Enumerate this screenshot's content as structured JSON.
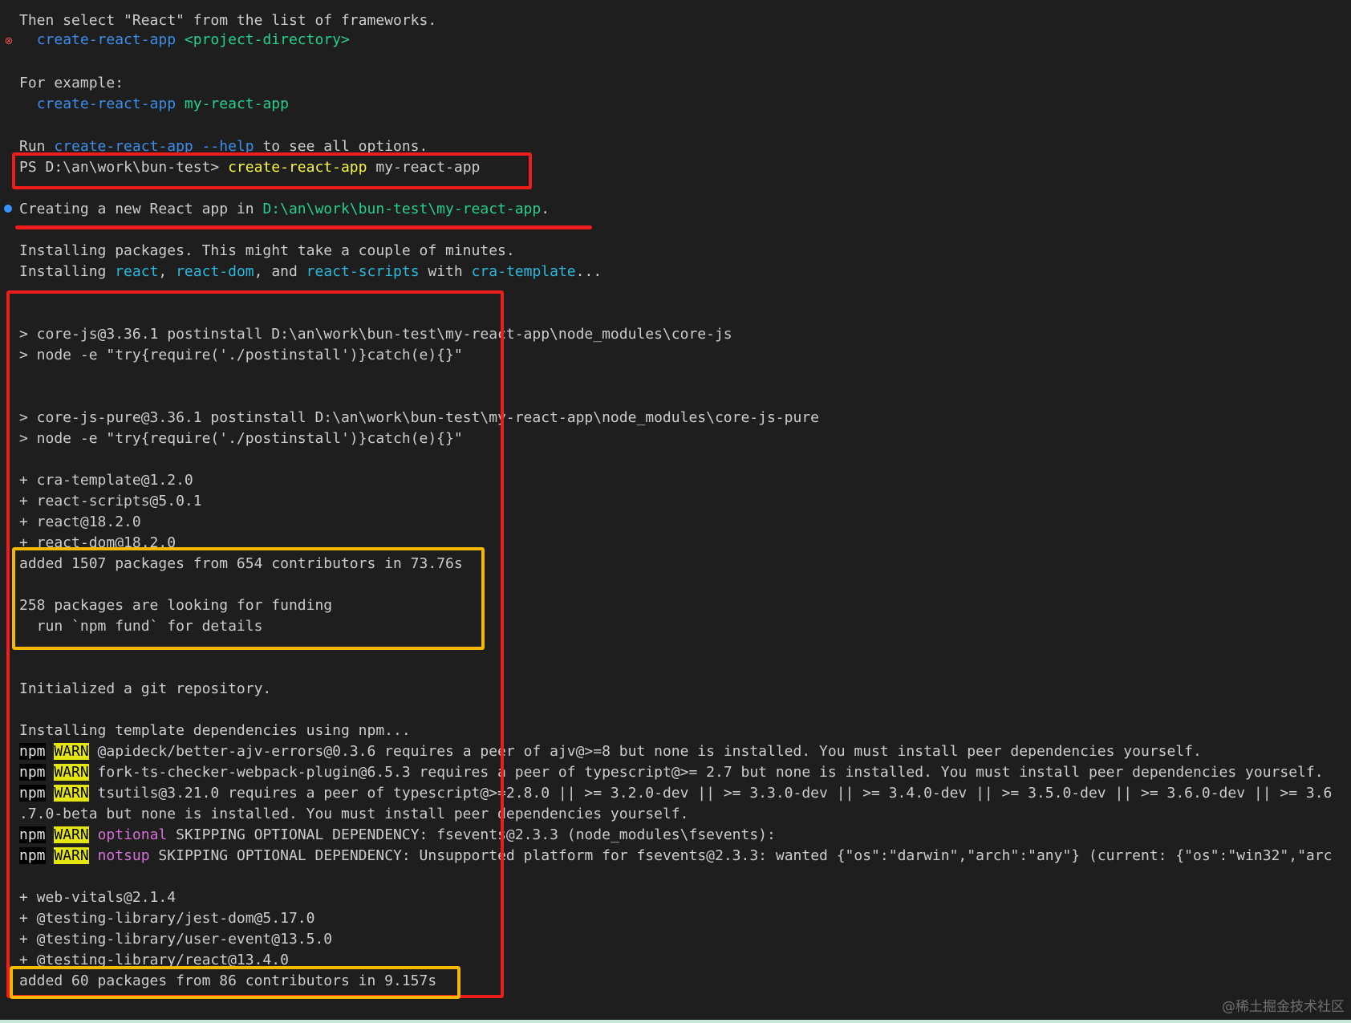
{
  "terminal": {
    "lines": {
      "select_react": "Then select \"React\" from the list of frameworks.",
      "usage_cmd": "create-react-app",
      "usage_arg": "<project-directory>",
      "for_example": "For example:",
      "example_cmd": "create-react-app",
      "example_arg": "my-react-app",
      "run_prefix": "Run ",
      "run_cmd": "create-react-app --help",
      "run_suffix": " to see all options.",
      "prompt": "PS D:\\an\\work\\bun-test> ",
      "prompt_cmd": "create-react-app",
      "prompt_arg": " my-react-app",
      "creating_prefix": "Creating a new React app in ",
      "creating_path": "D:\\an\\work\\bun-test\\my-react-app",
      "creating_suffix": ".",
      "installing_packages": "Installing packages. This might take a couple of minutes.",
      "installing_prefix": "Installing ",
      "pkg_react": "react",
      "sep1": ", ",
      "pkg_react_dom": "react-dom",
      "sep2": ", and ",
      "pkg_react_scripts": "react-scripts",
      "with_text": " with ",
      "pkg_cra_template": "cra-template",
      "ellipsis": "...",
      "corejs_postinstall": "> core-js@3.36.1 postinstall D:\\an\\work\\bun-test\\my-react-app\\node_modules\\core-js",
      "corejs_node": "> node -e \"try{require('./postinstall')}catch(e){}\"",
      "corejs_pure_postinstall": "> core-js-pure@3.36.1 postinstall D:\\an\\work\\bun-test\\my-react-app\\node_modules\\core-js-pure",
      "corejs_pure_node": "> node -e \"try{require('./postinstall')}catch(e){}\"",
      "added_cra_template": "+ cra-template@1.2.0",
      "added_react_scripts": "+ react-scripts@5.0.1",
      "added_react": "+ react@18.2.0",
      "added_react_dom": "+ react-dom@18.2.0",
      "added_summary_1": "added 1507 packages from 654 contributors in 73.76s",
      "funding_1": "258 packages are looking for funding",
      "funding_2": "  run `npm fund` for details",
      "git_init": "Initialized a git repository.",
      "installing_template": "Installing template dependencies using npm...",
      "npm_label": "npm",
      "warn_label": "WARN",
      "warn_1": " @apideck/better-ajv-errors@0.3.6 requires a peer of ajv@>=8 but none is installed. You must install peer dependencies yourself.",
      "warn_2": " fork-ts-checker-webpack-plugin@6.5.3 requires a peer of typescript@>= 2.7 but none is installed. You must install peer dependencies yourself.",
      "warn_3": " tsutils@3.21.0 requires a peer of typescript@>=2.8.0 || >= 3.2.0-dev || >= 3.3.0-dev || >= 3.4.0-dev || >= 3.5.0-dev || >= 3.6.0-dev || >= 3.6",
      "warn_3_cont": ".7.0-beta but none is installed. You must install peer dependencies yourself.",
      "optional_label": "optional",
      "warn_4": " SKIPPING OPTIONAL DEPENDENCY: fsevents@2.3.3 (node_modules\\fsevents):",
      "notsup_label": "notsup",
      "warn_5": " SKIPPING OPTIONAL DEPENDENCY: Unsupported platform for fsevents@2.3.3: wanted {\"os\":\"darwin\",\"arch\":\"any\"} (current: {\"os\":\"win32\",\"arc",
      "added_web_vitals": "+ web-vitals@2.1.4",
      "added_jest_dom": "+ @testing-library/jest-dom@5.17.0",
      "added_user_event": "+ @testing-library/user-event@13.5.0",
      "added_testing_react": "+ @testing-library/react@13.4.0",
      "added_summary_2": "added 60 packages from 86 contributors in 9.157s"
    },
    "gutter": {
      "error_glyph": "⊗",
      "error_icon": "error-circle-icon",
      "info_icon": "info-dot-icon"
    }
  },
  "watermark": "@稀土掘金技术社区",
  "colors": {
    "background": "#1e1e1e",
    "foreground": "#cccccc",
    "command_blue": "#3b8eea",
    "package_cyan": "#29b8db",
    "path_green": "#23d18b",
    "prompt_command_yellow": "#f5f543",
    "warn_badge": "#e5e510",
    "annotation_red": "#ef1c1c",
    "annotation_yellow": "#f5b800"
  }
}
